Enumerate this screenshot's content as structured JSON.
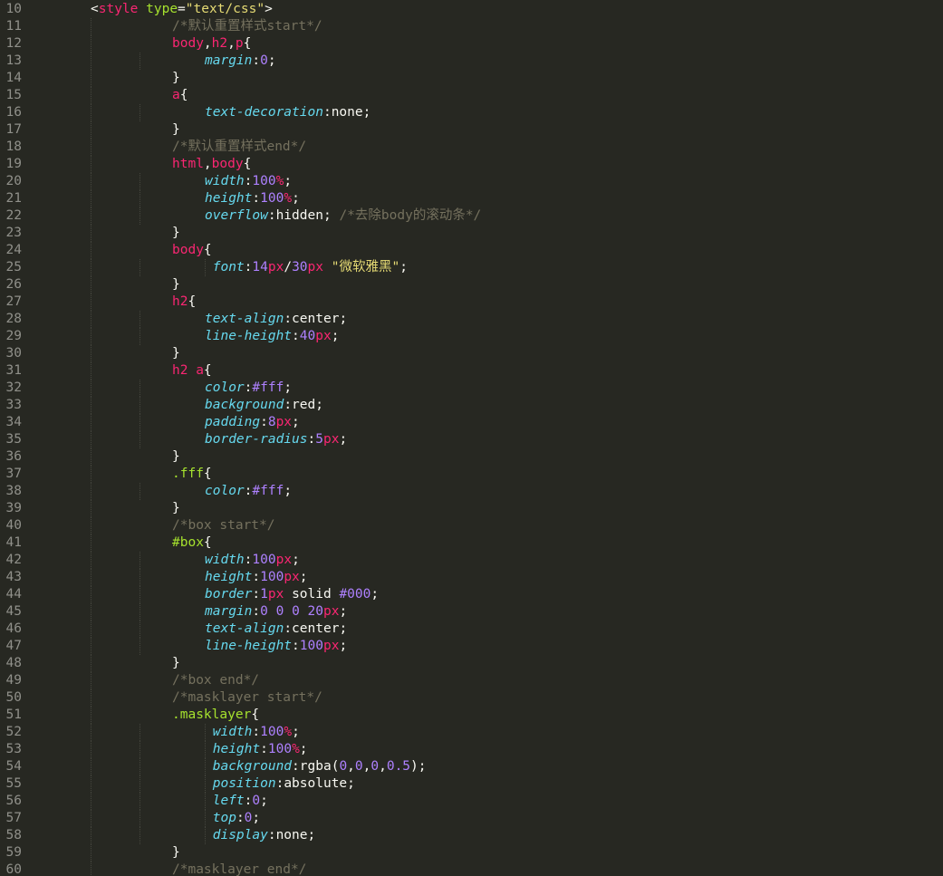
{
  "editor": {
    "first_line_number": 10,
    "lines": [
      {
        "n": "10",
        "indent": 1,
        "tokens": [
          [
            "punct",
            "<"
          ],
          [
            "tag",
            "style"
          ],
          [
            "plain",
            " "
          ],
          [
            "attr",
            "type"
          ],
          [
            "punct",
            "="
          ],
          [
            "str",
            "\"text/css\""
          ],
          [
            "punct",
            ">"
          ]
        ]
      },
      {
        "n": "11",
        "indent": 2,
        "tokens": [
          [
            "comment",
            "/*默认重置样式start*/"
          ]
        ]
      },
      {
        "n": "12",
        "indent": 2,
        "tokens": [
          [
            "sel",
            "body"
          ],
          [
            "punct",
            ","
          ],
          [
            "sel",
            "h2"
          ],
          [
            "punct",
            ","
          ],
          [
            "sel",
            "p"
          ],
          [
            "punct",
            "{"
          ]
        ]
      },
      {
        "n": "13",
        "indent": 3,
        "tokens": [
          [
            "prop",
            "margin"
          ],
          [
            "punct",
            ":"
          ],
          [
            "num",
            "0"
          ],
          [
            "punct",
            ";"
          ]
        ]
      },
      {
        "n": "14",
        "indent": 2,
        "tokens": [
          [
            "punct",
            "}"
          ]
        ]
      },
      {
        "n": "15",
        "indent": 2,
        "tokens": [
          [
            "sel",
            "a"
          ],
          [
            "punct",
            "{"
          ]
        ]
      },
      {
        "n": "16",
        "indent": 3,
        "tokens": [
          [
            "prop",
            "text-decoration"
          ],
          [
            "punct",
            ":"
          ],
          [
            "val",
            "none"
          ],
          [
            "punct",
            ";"
          ]
        ]
      },
      {
        "n": "17",
        "indent": 2,
        "tokens": [
          [
            "punct",
            "}"
          ]
        ]
      },
      {
        "n": "18",
        "indent": 2,
        "tokens": [
          [
            "comment",
            "/*默认重置样式end*/"
          ]
        ]
      },
      {
        "n": "19",
        "indent": 2,
        "tokens": [
          [
            "sel",
            "html"
          ],
          [
            "punct",
            ","
          ],
          [
            "sel",
            "body"
          ],
          [
            "punct",
            "{"
          ]
        ]
      },
      {
        "n": "20",
        "indent": 3,
        "tokens": [
          [
            "prop",
            "width"
          ],
          [
            "punct",
            ":"
          ],
          [
            "num",
            "100"
          ],
          [
            "unit",
            "%"
          ],
          [
            "punct",
            ";"
          ]
        ]
      },
      {
        "n": "21",
        "indent": 3,
        "tokens": [
          [
            "prop",
            "height"
          ],
          [
            "punct",
            ":"
          ],
          [
            "num",
            "100"
          ],
          [
            "unit",
            "%"
          ],
          [
            "punct",
            ";"
          ]
        ]
      },
      {
        "n": "22",
        "indent": 3,
        "tokens": [
          [
            "prop",
            "overflow"
          ],
          [
            "punct",
            ":"
          ],
          [
            "val",
            "hidden"
          ],
          [
            "punct",
            "; "
          ],
          [
            "comment",
            "/*去除body的滚动条*/"
          ]
        ]
      },
      {
        "n": "23",
        "indent": 2,
        "tokens": [
          [
            "punct",
            "}"
          ]
        ]
      },
      {
        "n": "24",
        "indent": 2,
        "tokens": [
          [
            "sel",
            "body"
          ],
          [
            "punct",
            "{"
          ]
        ]
      },
      {
        "n": "25",
        "indent": 3,
        "extra_guide": true,
        "tokens": [
          [
            "plain",
            " "
          ],
          [
            "prop",
            "font"
          ],
          [
            "punct",
            ":"
          ],
          [
            "num",
            "14"
          ],
          [
            "unit",
            "px"
          ],
          [
            "punct",
            "/"
          ],
          [
            "num",
            "30"
          ],
          [
            "unit",
            "px"
          ],
          [
            "plain",
            " "
          ],
          [
            "str",
            "\"微软雅黑\""
          ],
          [
            "punct",
            ";"
          ]
        ]
      },
      {
        "n": "26",
        "indent": 2,
        "tokens": [
          [
            "punct",
            "}"
          ]
        ]
      },
      {
        "n": "27",
        "indent": 2,
        "tokens": [
          [
            "sel",
            "h2"
          ],
          [
            "punct",
            "{"
          ]
        ]
      },
      {
        "n": "28",
        "indent": 3,
        "tokens": [
          [
            "prop",
            "text-align"
          ],
          [
            "punct",
            ":"
          ],
          [
            "val",
            "center"
          ],
          [
            "punct",
            ";"
          ]
        ]
      },
      {
        "n": "29",
        "indent": 3,
        "tokens": [
          [
            "prop",
            "line-height"
          ],
          [
            "punct",
            ":"
          ],
          [
            "num",
            "40"
          ],
          [
            "unit",
            "px"
          ],
          [
            "punct",
            ";"
          ]
        ]
      },
      {
        "n": "30",
        "indent": 2,
        "tokens": [
          [
            "punct",
            "}"
          ]
        ]
      },
      {
        "n": "31",
        "indent": 2,
        "tokens": [
          [
            "sel",
            "h2 a"
          ],
          [
            "punct",
            "{"
          ]
        ]
      },
      {
        "n": "32",
        "indent": 3,
        "tokens": [
          [
            "prop",
            "color"
          ],
          [
            "punct",
            ":"
          ],
          [
            "hex",
            "#fff"
          ],
          [
            "punct",
            ";"
          ]
        ]
      },
      {
        "n": "33",
        "indent": 3,
        "tokens": [
          [
            "prop",
            "background"
          ],
          [
            "punct",
            ":"
          ],
          [
            "val",
            "red"
          ],
          [
            "punct",
            ";"
          ]
        ]
      },
      {
        "n": "34",
        "indent": 3,
        "tokens": [
          [
            "prop",
            "padding"
          ],
          [
            "punct",
            ":"
          ],
          [
            "num",
            "8"
          ],
          [
            "unit",
            "px"
          ],
          [
            "punct",
            ";"
          ]
        ]
      },
      {
        "n": "35",
        "indent": 3,
        "tokens": [
          [
            "prop",
            "border-radius"
          ],
          [
            "punct",
            ":"
          ],
          [
            "num",
            "5"
          ],
          [
            "unit",
            "px"
          ],
          [
            "punct",
            ";"
          ]
        ]
      },
      {
        "n": "36",
        "indent": 2,
        "tokens": [
          [
            "punct",
            "}"
          ]
        ]
      },
      {
        "n": "37",
        "indent": 2,
        "tokens": [
          [
            "sel-cls",
            ".fff"
          ],
          [
            "punct",
            "{"
          ]
        ]
      },
      {
        "n": "38",
        "indent": 3,
        "tokens": [
          [
            "prop",
            "color"
          ],
          [
            "punct",
            ":"
          ],
          [
            "hex",
            "#fff"
          ],
          [
            "punct",
            ";"
          ]
        ]
      },
      {
        "n": "39",
        "indent": 2,
        "tokens": [
          [
            "punct",
            "}"
          ]
        ]
      },
      {
        "n": "40",
        "indent": 2,
        "tokens": [
          [
            "comment",
            "/*box start*/"
          ]
        ]
      },
      {
        "n": "41",
        "indent": 2,
        "tokens": [
          [
            "sel-cls",
            "#box"
          ],
          [
            "punct",
            "{"
          ]
        ]
      },
      {
        "n": "42",
        "indent": 3,
        "tokens": [
          [
            "prop",
            "width"
          ],
          [
            "punct",
            ":"
          ],
          [
            "num",
            "100"
          ],
          [
            "unit",
            "px"
          ],
          [
            "punct",
            ";"
          ]
        ]
      },
      {
        "n": "43",
        "indent": 3,
        "tokens": [
          [
            "prop",
            "height"
          ],
          [
            "punct",
            ":"
          ],
          [
            "num",
            "100"
          ],
          [
            "unit",
            "px"
          ],
          [
            "punct",
            ";"
          ]
        ]
      },
      {
        "n": "44",
        "indent": 3,
        "tokens": [
          [
            "prop",
            "border"
          ],
          [
            "punct",
            ":"
          ],
          [
            "num",
            "1"
          ],
          [
            "unit",
            "px"
          ],
          [
            "plain",
            " "
          ],
          [
            "val",
            "solid"
          ],
          [
            "plain",
            " "
          ],
          [
            "hex",
            "#000"
          ],
          [
            "punct",
            ";"
          ]
        ]
      },
      {
        "n": "45",
        "indent": 3,
        "tokens": [
          [
            "prop",
            "margin"
          ],
          [
            "punct",
            ":"
          ],
          [
            "num",
            "0"
          ],
          [
            "plain",
            " "
          ],
          [
            "num",
            "0"
          ],
          [
            "plain",
            " "
          ],
          [
            "num",
            "0"
          ],
          [
            "plain",
            " "
          ],
          [
            "num",
            "20"
          ],
          [
            "unit",
            "px"
          ],
          [
            "punct",
            ";"
          ]
        ]
      },
      {
        "n": "46",
        "indent": 3,
        "tokens": [
          [
            "prop",
            "text-align"
          ],
          [
            "punct",
            ":"
          ],
          [
            "val",
            "center"
          ],
          [
            "punct",
            ";"
          ]
        ]
      },
      {
        "n": "47",
        "indent": 3,
        "tokens": [
          [
            "prop",
            "line-height"
          ],
          [
            "punct",
            ":"
          ],
          [
            "num",
            "100"
          ],
          [
            "unit",
            "px"
          ],
          [
            "punct",
            ";"
          ]
        ]
      },
      {
        "n": "48",
        "indent": 2,
        "tokens": [
          [
            "punct",
            "}"
          ]
        ]
      },
      {
        "n": "49",
        "indent": 2,
        "tokens": [
          [
            "comment",
            "/*box end*/"
          ]
        ]
      },
      {
        "n": "50",
        "indent": 2,
        "tokens": [
          [
            "comment",
            "/*masklayer start*/"
          ]
        ]
      },
      {
        "n": "51",
        "indent": 2,
        "tokens": [
          [
            "sel-cls",
            ".masklayer"
          ],
          [
            "punct",
            "{"
          ]
        ]
      },
      {
        "n": "52",
        "indent": 3,
        "extra_guide": true,
        "tokens": [
          [
            "plain",
            " "
          ],
          [
            "prop",
            "width"
          ],
          [
            "punct",
            ":"
          ],
          [
            "num",
            "100"
          ],
          [
            "unit",
            "%"
          ],
          [
            "punct",
            ";"
          ]
        ]
      },
      {
        "n": "53",
        "indent": 3,
        "extra_guide": true,
        "tokens": [
          [
            "plain",
            " "
          ],
          [
            "prop",
            "height"
          ],
          [
            "punct",
            ":"
          ],
          [
            "num",
            "100"
          ],
          [
            "unit",
            "%"
          ],
          [
            "punct",
            ";"
          ]
        ]
      },
      {
        "n": "54",
        "indent": 3,
        "extra_guide": true,
        "tokens": [
          [
            "plain",
            " "
          ],
          [
            "prop",
            "background"
          ],
          [
            "punct",
            ":"
          ],
          [
            "val",
            "rgba("
          ],
          [
            "num",
            "0"
          ],
          [
            "punct",
            ","
          ],
          [
            "num",
            "0"
          ],
          [
            "punct",
            ","
          ],
          [
            "num",
            "0"
          ],
          [
            "punct",
            ","
          ],
          [
            "num",
            "0.5"
          ],
          [
            "val",
            ")"
          ],
          [
            "punct",
            ";"
          ]
        ]
      },
      {
        "n": "55",
        "indent": 3,
        "extra_guide": true,
        "tokens": [
          [
            "plain",
            " "
          ],
          [
            "prop",
            "position"
          ],
          [
            "punct",
            ":"
          ],
          [
            "val",
            "absolute"
          ],
          [
            "punct",
            ";"
          ]
        ]
      },
      {
        "n": "56",
        "indent": 3,
        "extra_guide": true,
        "tokens": [
          [
            "plain",
            " "
          ],
          [
            "prop",
            "left"
          ],
          [
            "punct",
            ":"
          ],
          [
            "num",
            "0"
          ],
          [
            "punct",
            ";"
          ]
        ]
      },
      {
        "n": "57",
        "indent": 3,
        "extra_guide": true,
        "tokens": [
          [
            "plain",
            " "
          ],
          [
            "prop",
            "top"
          ],
          [
            "punct",
            ":"
          ],
          [
            "num",
            "0"
          ],
          [
            "punct",
            ";"
          ]
        ]
      },
      {
        "n": "58",
        "indent": 3,
        "extra_guide": true,
        "tokens": [
          [
            "plain",
            " "
          ],
          [
            "prop",
            "display"
          ],
          [
            "punct",
            ":"
          ],
          [
            "val",
            "none"
          ],
          [
            "punct",
            ";"
          ]
        ]
      },
      {
        "n": "59",
        "indent": 2,
        "tokens": [
          [
            "punct",
            "}"
          ]
        ]
      },
      {
        "n": "60",
        "indent": 2,
        "tokens": [
          [
            "comment",
            "/*masklayer end*/"
          ]
        ]
      }
    ]
  }
}
